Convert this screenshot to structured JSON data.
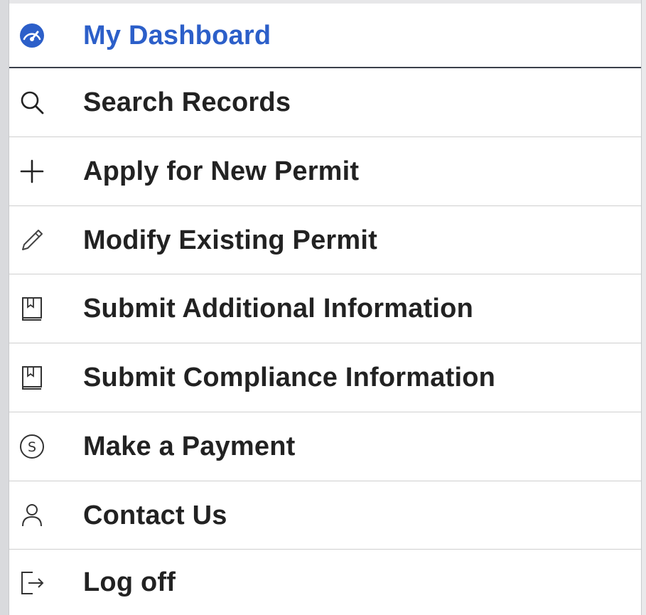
{
  "menu": {
    "items": [
      {
        "label": "My Dashboard",
        "icon": "dashboard-gauge-icon",
        "active": true
      },
      {
        "label": "Search Records",
        "icon": "search-icon",
        "active": false
      },
      {
        "label": "Apply for New Permit",
        "icon": "plus-icon",
        "active": false
      },
      {
        "label": "Modify Existing Permit",
        "icon": "pencil-icon",
        "active": false
      },
      {
        "label": "Submit Additional Information",
        "icon": "book-icon",
        "active": false
      },
      {
        "label": "Submit Compliance Information",
        "icon": "book-icon",
        "active": false
      },
      {
        "label": "Make a Payment",
        "icon": "dollar-circle-icon",
        "active": false
      },
      {
        "label": "Contact Us",
        "icon": "person-icon",
        "active": false
      },
      {
        "label": "Log off",
        "icon": "logout-icon",
        "active": false
      }
    ]
  },
  "colors": {
    "active_text": "#2c5fc9",
    "text": "#222222",
    "divider": "#cfcfcf",
    "active_divider": "#3a3f4a"
  }
}
